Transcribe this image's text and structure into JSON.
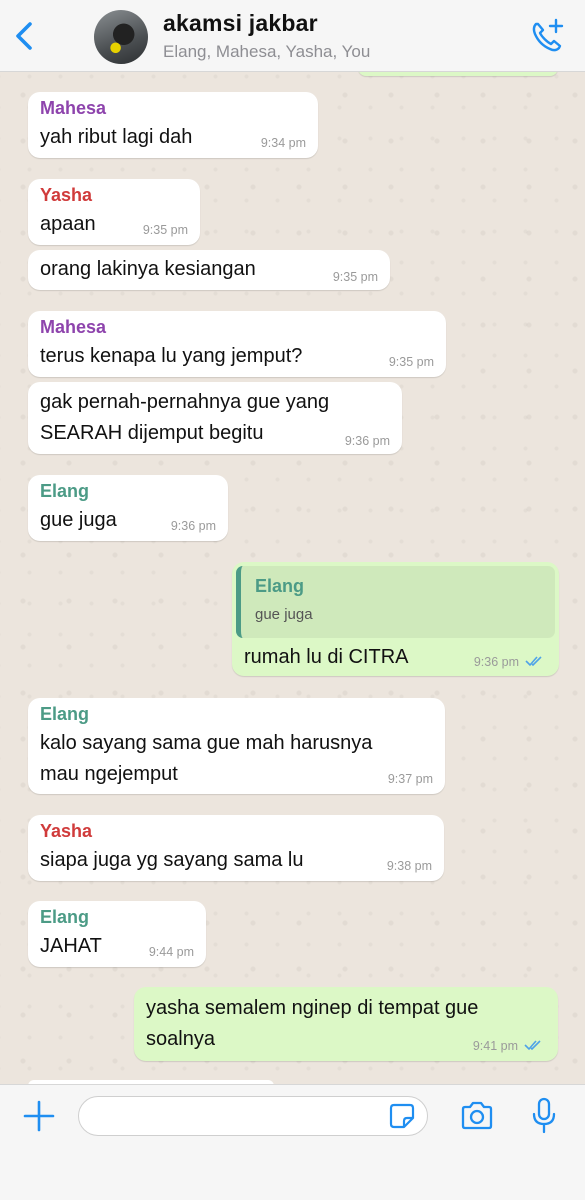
{
  "header": {
    "title": "akamsi jakbar",
    "members": "Elang, Mahesa, Yasha, You"
  },
  "colors": {
    "accent": "#1f8ef1",
    "sender_mahesa": "#8e44ad",
    "sender_yasha": "#d03b3b",
    "sender_elang": "#4c9b86",
    "outgoing_bubble": "#dcf8c6",
    "incoming_bubble": "#ffffff"
  },
  "icons": {
    "back": "chevron-left-icon",
    "call": "phone-plus-icon",
    "attach": "plus-icon",
    "sticker": "sticker-icon",
    "camera": "camera-icon",
    "mic": "microphone-icon",
    "read": "double-check-icon"
  },
  "messages": [
    {
      "sender": "Mahesa",
      "text": "yah ribut lagi dah",
      "time": "9:34 pm"
    },
    {
      "sender": "Yasha",
      "text": "apaan",
      "time": "9:35 pm"
    },
    {
      "sender": "",
      "text": "orang lakinya kesiangan",
      "time": "9:35 pm"
    },
    {
      "sender": "Mahesa",
      "text": "terus kenapa lu yang jemput?",
      "time": "9:35 pm"
    },
    {
      "sender": "",
      "text": "gak pernah-pernahnya gue yang\nSEARAH dijemput begitu",
      "time": "9:36 pm"
    },
    {
      "sender": "Elang",
      "text": "gue juga",
      "time": "9:36 pm"
    },
    {
      "sender": "You",
      "quote_sender": "Elang",
      "quote_text": "gue juga",
      "text": "rumah lu di CITRA",
      "time": "9:36 pm"
    },
    {
      "sender": "Elang",
      "text": "kalo sayang sama gue mah harusnya\nmau ngejemput",
      "time": "9:37 pm"
    },
    {
      "sender": "Yasha",
      "text": "siapa juga yg sayang sama lu",
      "time": "9:38 pm"
    },
    {
      "sender": "Elang",
      "text": "JAHAT",
      "time": "9:44 pm"
    },
    {
      "sender": "You",
      "text": "yasha semalem nginep di tempat gue\nsoalnya",
      "time": "9:41 pm"
    }
  ],
  "input": {
    "placeholder": ""
  }
}
